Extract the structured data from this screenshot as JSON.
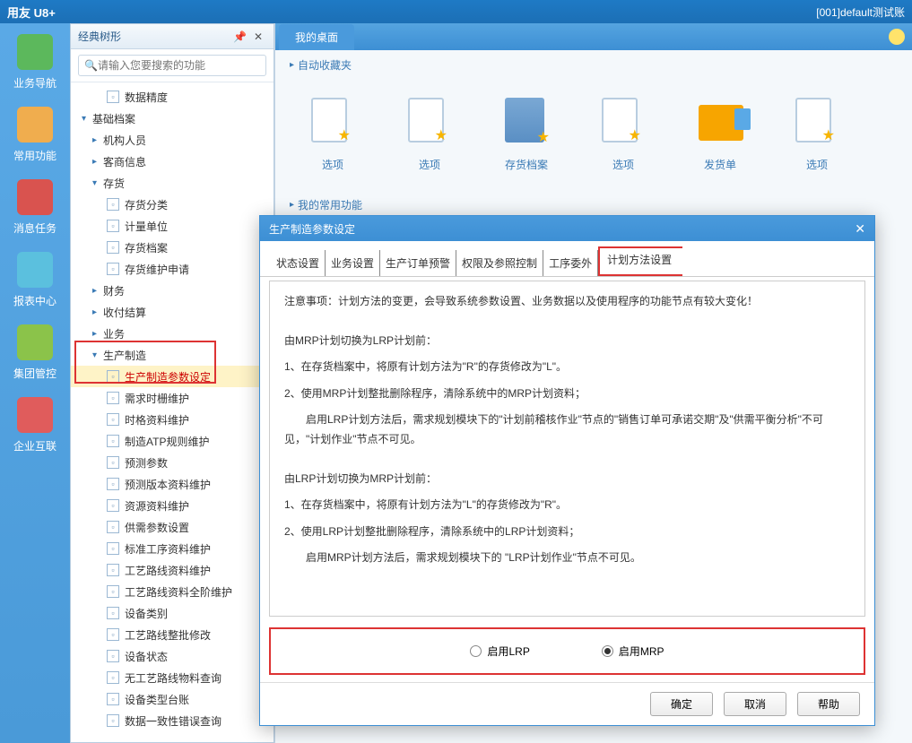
{
  "titlebar": {
    "app": "用友 U8+",
    "account": "[001]default测试账"
  },
  "sidebar": [
    {
      "label": "业务导航",
      "color": "#5cb85c"
    },
    {
      "label": "常用功能",
      "color": "#f0ad4e"
    },
    {
      "label": "消息任务",
      "color": "#d9534f"
    },
    {
      "label": "报表中心",
      "color": "#5bc0de"
    },
    {
      "label": "集团管控",
      "color": "#8bc34a"
    },
    {
      "label": "企业互联",
      "color": "#e05c5c"
    }
  ],
  "treeHeader": {
    "title": "经典树形"
  },
  "search": {
    "placeholder": "请输入您要搜索的功能"
  },
  "tree": {
    "n0": "数据精度",
    "n1": "基础档案",
    "n2": "机构人员",
    "n3": "客商信息",
    "n4": "存货",
    "n5": "存货分类",
    "n6": "计量单位",
    "n7": "存货档案",
    "n8": "存货维护申请",
    "n9": "财务",
    "n10": "收付结算",
    "n11": "业务",
    "n12": "生产制造",
    "n13": "生产制造参数设定",
    "n14": "需求时栅维护",
    "n15": "时格资料维护",
    "n16": "制造ATP规则维护",
    "n17": "预测参数",
    "n18": "预测版本资料维护",
    "n19": "资源资料维护",
    "n20": "供需参数设置",
    "n21": "标准工序资料维护",
    "n22": "工艺路线资料维护",
    "n23": "工艺路线资料全阶维护",
    "n24": "设备类别",
    "n25": "工艺路线整批修改",
    "n26": "设备状态",
    "n27": "无工艺路线物料查询",
    "n28": "设备类型台账",
    "n29": "数据一致性错误查询"
  },
  "desktop": {
    "tab": "我的桌面",
    "fav": "自动收藏夹",
    "common": "我的常用功能",
    "items": {
      "i0": "选项",
      "i1": "选项",
      "i2": "存货档案",
      "i3": "选项",
      "i4": "发货单",
      "i5": "选项"
    }
  },
  "dialog": {
    "title": "生产制造参数设定",
    "tabs": {
      "t0": "状态设置",
      "t1": "业务设置",
      "t2": "生产订单预警",
      "t3": "权限及参照控制",
      "t4": "工序委外",
      "t5": "计划方法设置"
    },
    "body": {
      "p0": "注意事项：计划方法的变更，会导致系统参数设置、业务数据以及使用程序的功能节点有较大变化！",
      "p1": "由MRP计划切换为LRP计划前：",
      "p2": "1、在存货档案中，将原有计划方法为\"R\"的存货修改为\"L\"。",
      "p3": "2、使用MRP计划整批删除程序，清除系统中的MRP计划资料；",
      "p4": "　　启用LRP计划方法后，需求规划模块下的\"计划前稽核作业\"节点的\"销售订单可承诺交期\"及\"供需平衡分析\"不可见，\"计划作业\"节点不可见。",
      "p5": "由LRP计划切换为MRP计划前：",
      "p6": "1、在存货档案中，将原有计划方法为\"L\"的存货修改为\"R\"。",
      "p7": "2、使用LRP计划整批删除程序，清除系统中的LRP计划资料；",
      "p8": "　　启用MRP计划方法后，需求规划模块下的 \"LRP计划作业\"节点不可见。"
    },
    "radio": {
      "r0": "启用LRP",
      "r1": "启用MRP"
    },
    "buttons": {
      "ok": "确定",
      "cancel": "取消",
      "help": "帮助"
    }
  }
}
